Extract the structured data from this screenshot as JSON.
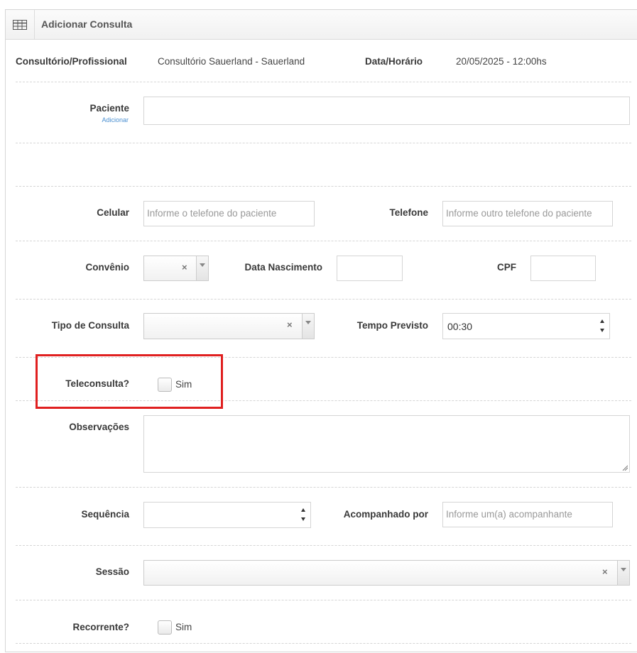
{
  "header": {
    "title": "Adicionar Consulta",
    "icon": "table-icon"
  },
  "info": {
    "consultorio_label": "Consultório/Profissional",
    "consultorio_value": "Consultório Sauerland - Sauerland",
    "datahora_label": "Data/Horário",
    "datahora_value": "20/05/2025 - 12:00hs"
  },
  "form": {
    "paciente_label": "Paciente",
    "paciente_link": "Adicionar",
    "paciente_value": "",
    "celular_label": "Celular",
    "celular_placeholder": "Informe o telefone do paciente",
    "telefone_label": "Telefone",
    "telefone_placeholder": "Informe outro telefone do paciente",
    "convenio_label": "Convênio",
    "convenio_value": "",
    "nascimento_label": "Data Nascimento",
    "nascimento_value": "",
    "cpf_label": "CPF",
    "cpf_value": "",
    "tipo_label": "Tipo de Consulta",
    "tipo_value": "",
    "tempo_label": "Tempo Previsto",
    "tempo_value": "00:30",
    "teleconsulta_label": "Teleconsulta?",
    "teleconsulta_option": "Sim",
    "teleconsulta_checked": false,
    "observacoes_label": "Observações",
    "observacoes_value": "",
    "sequencia_label": "Sequência",
    "sequencia_value": "",
    "acompanhado_label": "Acompanhado por",
    "acompanhado_placeholder": "Informe um(a) acompanhante",
    "sessao_label": "Sessão",
    "sessao_value": "",
    "recorrente_label": "Recorrente?",
    "recorrente_option": "Sim",
    "recorrente_checked": false
  },
  "clear_symbol": "×",
  "colors": {
    "highlight_border": "#e02020",
    "link": "#4a8fd1"
  }
}
